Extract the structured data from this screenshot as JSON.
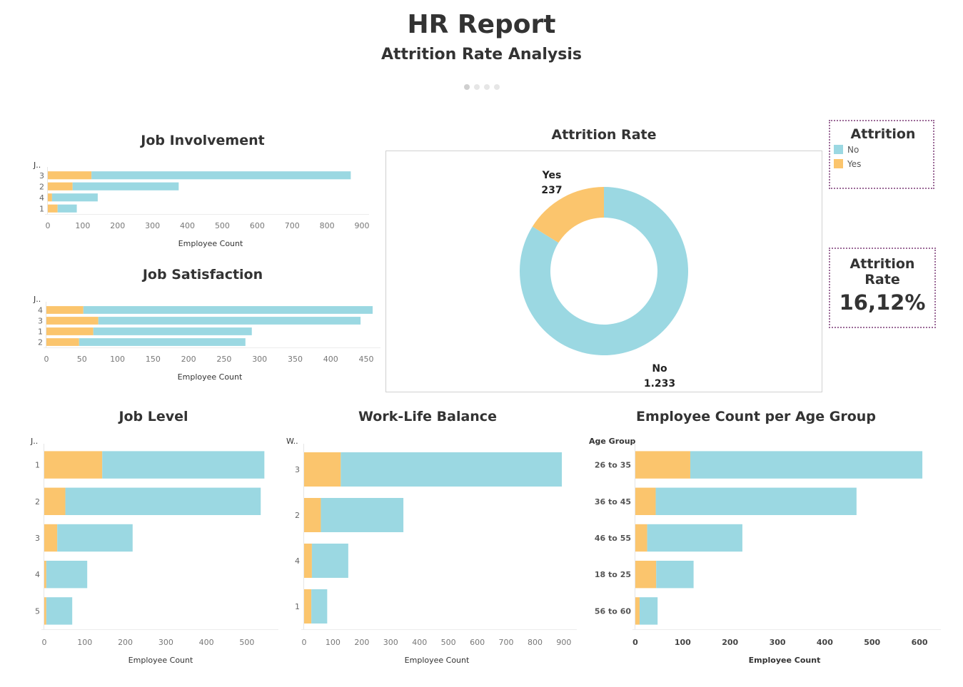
{
  "header": {
    "title": "HR Report",
    "subtitle": "Attrition Rate Analysis"
  },
  "colors": {
    "no": "#9bd8e2",
    "yes": "#fbc56d",
    "border": "#9c6b98"
  },
  "legend": {
    "title": "Attrition",
    "items": [
      {
        "label": "No",
        "color": "#9bd8e2"
      },
      {
        "label": "Yes",
        "color": "#fbc56d"
      }
    ]
  },
  "kpi": {
    "title": "Attrition Rate",
    "value": "16,12%"
  },
  "chart_data": [
    {
      "id": "job-involvement",
      "type": "bar",
      "stacked": true,
      "orientation": "horizontal",
      "title": "Job Involvement",
      "ylabel": "J..",
      "xlabel": "Employee Count",
      "categories": [
        "3",
        "2",
        "4",
        "1"
      ],
      "series": [
        {
          "name": "Yes",
          "values": [
            125,
            71,
            12,
            28
          ]
        },
        {
          "name": "No",
          "values": [
            743,
            304,
            131,
            55
          ]
        }
      ],
      "xlim": [
        0,
        900
      ],
      "xticks": [
        0,
        100,
        200,
        300,
        400,
        500,
        600,
        700,
        800,
        900
      ]
    },
    {
      "id": "job-satisfaction",
      "type": "bar",
      "stacked": true,
      "orientation": "horizontal",
      "title": "Job Satisfaction",
      "ylabel": "J..",
      "xlabel": "Employee Count",
      "categories": [
        "4",
        "3",
        "1",
        "2"
      ],
      "series": [
        {
          "name": "Yes",
          "values": [
            52,
            73,
            66,
            46
          ]
        },
        {
          "name": "No",
          "values": [
            407,
            369,
            223,
            234
          ]
        }
      ],
      "xlim": [
        0,
        460
      ],
      "xticks": [
        0,
        50,
        100,
        150,
        200,
        250,
        300,
        350,
        400,
        450
      ]
    },
    {
      "id": "attrition-rate",
      "type": "pie",
      "donut": true,
      "title": "Attrition Rate",
      "slices": [
        {
          "name": "No",
          "label": "No",
          "value": 1233,
          "value_label": "1.233"
        },
        {
          "name": "Yes",
          "label": "Yes",
          "value": 237,
          "value_label": "237"
        }
      ]
    },
    {
      "id": "job-level",
      "type": "bar",
      "stacked": true,
      "orientation": "horizontal",
      "title": "Job Level",
      "ylabel": "J..",
      "xlabel": "Employee Count",
      "categories": [
        "1",
        "2",
        "3",
        "4",
        "5"
      ],
      "series": [
        {
          "name": "Yes",
          "values": [
            143,
            52,
            32,
            5,
            5
          ]
        },
        {
          "name": "No",
          "values": [
            400,
            482,
            186,
            101,
            64
          ]
        }
      ],
      "xlim": [
        0,
        560
      ],
      "xticks": [
        0,
        100,
        200,
        300,
        400,
        500
      ]
    },
    {
      "id": "work-life-balance",
      "type": "bar",
      "stacked": true,
      "orientation": "horizontal",
      "title": "Work-Life Balance",
      "ylabel": "W..",
      "xlabel": "Employee Count",
      "categories": [
        "3",
        "2",
        "4",
        "1"
      ],
      "series": [
        {
          "name": "Yes",
          "values": [
            127,
            58,
            27,
            25
          ]
        },
        {
          "name": "No",
          "values": [
            766,
            286,
            126,
            55
          ]
        }
      ],
      "xlim": [
        0,
        920
      ],
      "xticks": [
        0,
        100,
        200,
        300,
        400,
        500,
        600,
        700,
        800,
        900
      ]
    },
    {
      "id": "age-group",
      "type": "bar",
      "stacked": true,
      "orientation": "horizontal",
      "title": "Employee Count per Age Group",
      "ylabel": "Age Group",
      "xlabel": "Employee Count",
      "categories": [
        "26 to 35",
        "36 to 45",
        "46 to 55",
        "18 to 25",
        "56 to 60"
      ],
      "series": [
        {
          "name": "Yes",
          "values": [
            116,
            43,
            25,
            44,
            9
          ]
        },
        {
          "name": "No",
          "values": [
            490,
            424,
            201,
            79,
            38
          ]
        }
      ],
      "xlim": [
        0,
        630
      ],
      "xticks": [
        0,
        100,
        200,
        300,
        400,
        500,
        600
      ]
    }
  ]
}
